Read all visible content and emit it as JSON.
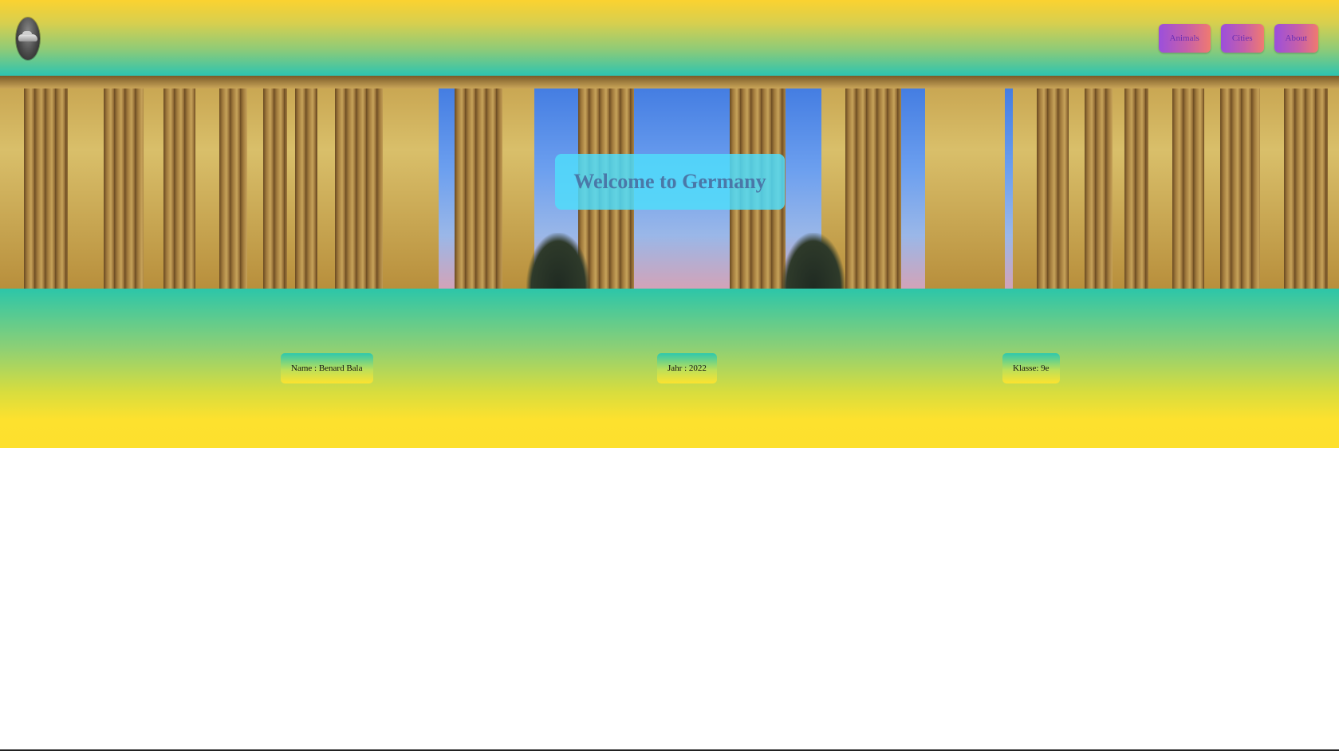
{
  "header": {
    "logo_icon": "car-logo-icon",
    "nav": [
      {
        "label": "Animals"
      },
      {
        "label": "Cities"
      },
      {
        "label": "About"
      }
    ]
  },
  "hero": {
    "title": "Welcome to Germany",
    "image": "brandenburg-gate-photo"
  },
  "info": {
    "name": "Name : Benard Bala",
    "year": "Jahr : 2022",
    "class": "Klasse: 9e"
  },
  "colors": {
    "header_top": "#fbd230",
    "header_bottom": "#2dc4b0",
    "nav_gradient_start": "#9b4fdc",
    "nav_gradient_end": "#f07a70",
    "welcome_box": "#50dcfa",
    "band_bottom": "#fde02d"
  }
}
